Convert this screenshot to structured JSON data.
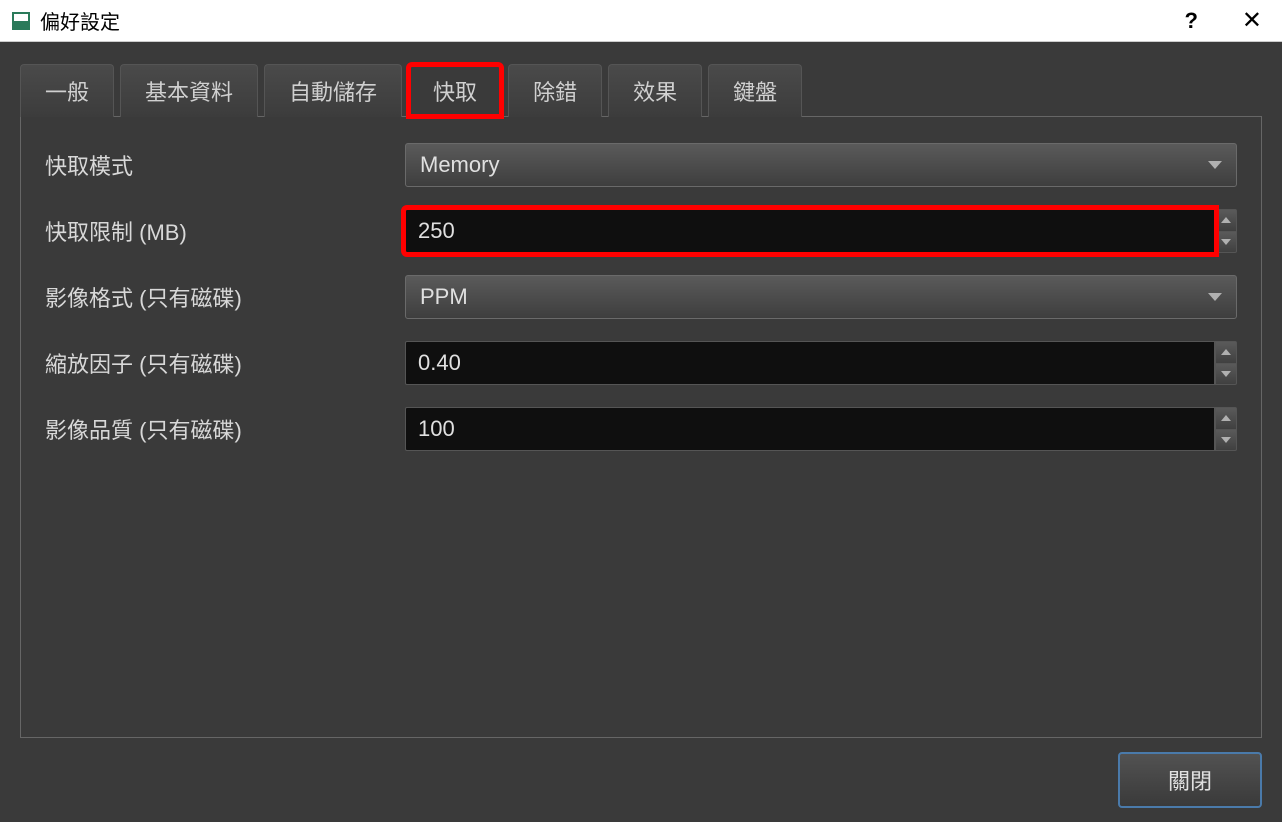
{
  "window": {
    "title": "偏好設定"
  },
  "tabs": [
    {
      "label": "一般",
      "active": false
    },
    {
      "label": "基本資料",
      "active": false
    },
    {
      "label": "自動儲存",
      "active": false
    },
    {
      "label": "快取",
      "active": true,
      "highlighted": true
    },
    {
      "label": "除錯",
      "active": false
    },
    {
      "label": "效果",
      "active": false
    },
    {
      "label": "鍵盤",
      "active": false
    }
  ],
  "fields": {
    "cache_mode": {
      "label": "快取模式",
      "value": "Memory"
    },
    "cache_limit": {
      "label": "快取限制 (MB)",
      "value": "250",
      "highlighted": true
    },
    "image_format": {
      "label": "影像格式 (只有磁碟)",
      "value": "PPM"
    },
    "scale_factor": {
      "label": "縮放因子 (只有磁碟)",
      "value": "0.40"
    },
    "image_quality": {
      "label": "影像品質 (只有磁碟)",
      "value": "100"
    }
  },
  "buttons": {
    "close": "關閉"
  }
}
